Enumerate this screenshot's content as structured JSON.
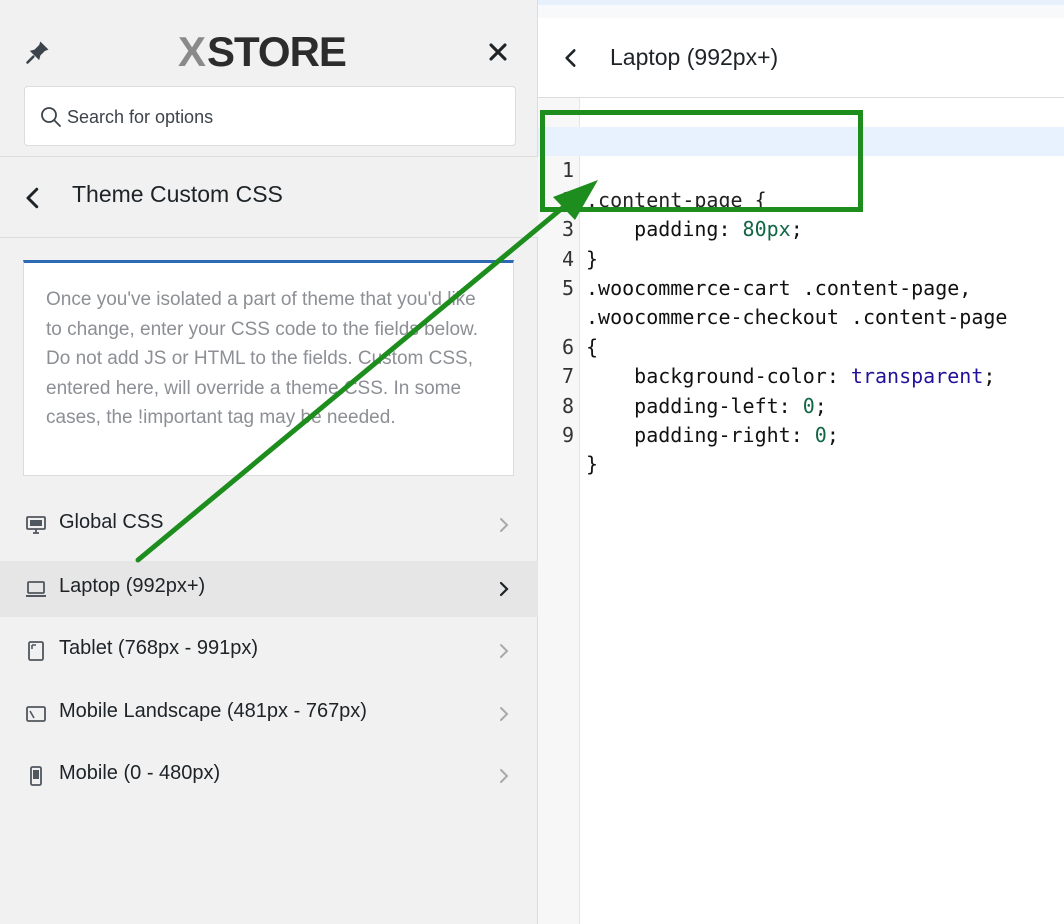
{
  "brand": {
    "logo_x": "X",
    "logo_text": "STORE"
  },
  "search": {
    "placeholder": "Search for options"
  },
  "section": {
    "title": "Theme Custom CSS"
  },
  "description": "Once you've isolated a part of theme that you'd like to change, enter your CSS code to the fields below. Do not add JS or HTML to the fields. Custom CSS, entered here, will override a theme CSS. In some cases, the !important tag may be needed.",
  "nav": {
    "items": [
      {
        "label": "Global CSS",
        "icon": "desktop-icon",
        "active": false
      },
      {
        "label": "Laptop (992px+)",
        "icon": "laptop-icon",
        "active": true
      },
      {
        "label": "Tablet (768px - 991px)",
        "icon": "tablet-icon",
        "active": false
      },
      {
        "label": "Mobile Landscape (481px - 767px)",
        "icon": "mobile-landscape-icon",
        "active": false
      },
      {
        "label": "Mobile (0 - 480px)",
        "icon": "mobile-icon",
        "active": false
      }
    ]
  },
  "panel": {
    "title": "Laptop (992px+)"
  },
  "editor": {
    "line_numbers": [
      "1",
      "2",
      "3",
      "4",
      "5",
      "",
      "6",
      "7",
      "8",
      "9"
    ],
    "lines": [
      ".content-page {",
      "    padding: 80px;",
      "}",
      ".woocommerce-cart .content-page,",
      ".woocommerce-checkout .content-page",
      "{",
      "    background-color: transparent;",
      "    padding-left: 0;",
      "    padding-right: 0;",
      "}"
    ]
  },
  "annotation": {
    "color": "#1d8d1d"
  }
}
